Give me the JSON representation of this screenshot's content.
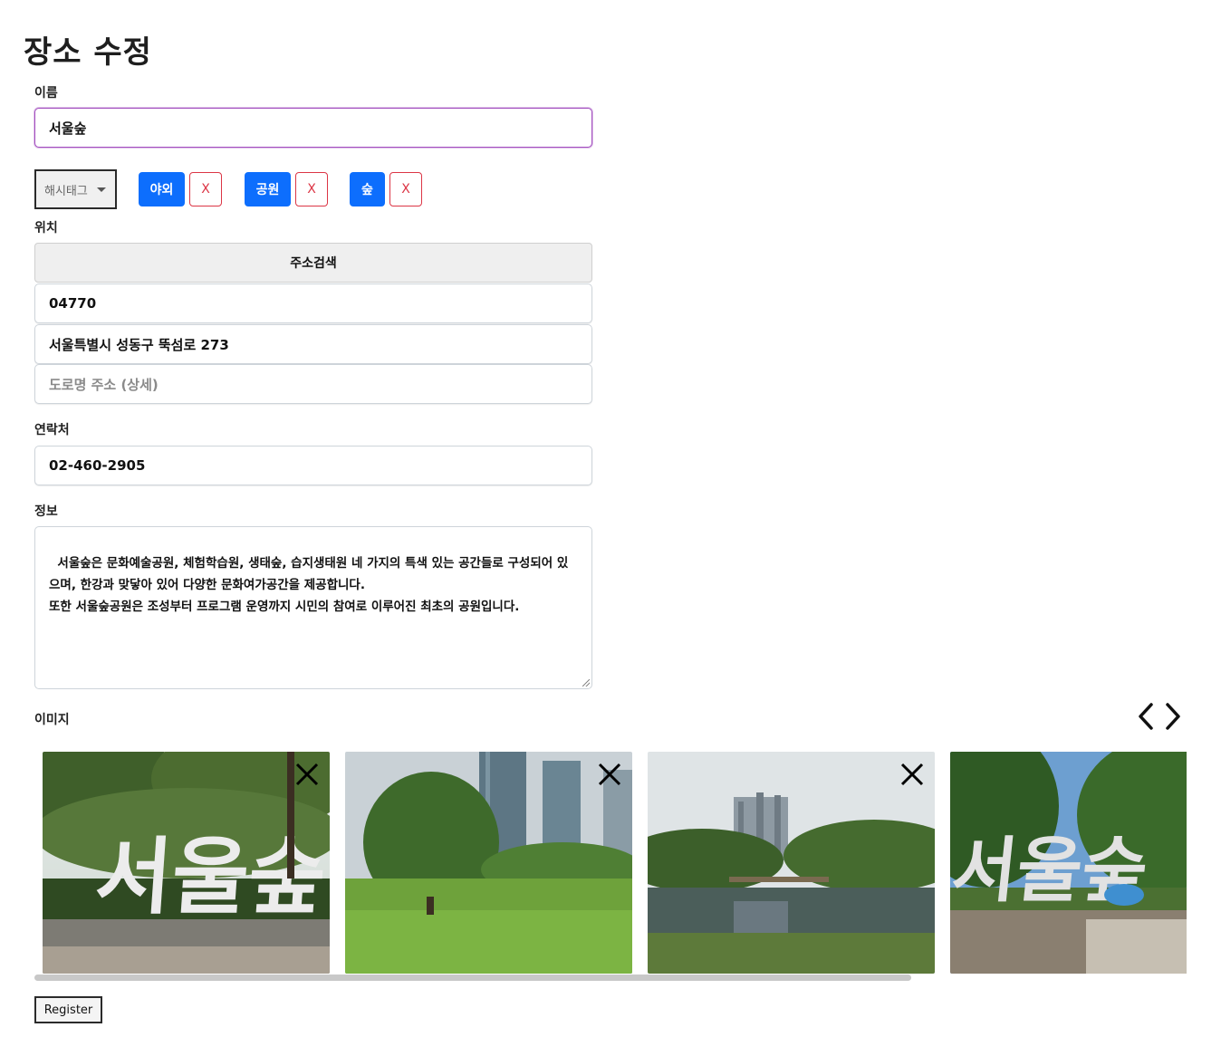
{
  "page": {
    "title": "장소 수정"
  },
  "name": {
    "label": "이름",
    "value": "서울숲"
  },
  "hashtag": {
    "select_label": "해시태그",
    "tags": [
      {
        "label": "야외",
        "remove": "X"
      },
      {
        "label": "공원",
        "remove": "X"
      },
      {
        "label": "숲",
        "remove": "X"
      }
    ]
  },
  "location": {
    "label": "위치",
    "search_button": "주소검색",
    "postcode": "04770",
    "address": "서울특별시 성동구 뚝섬로 273",
    "detail_placeholder": "도로명 주소 (상세)"
  },
  "contact": {
    "label": "연락처",
    "value": "02-460-2905"
  },
  "info": {
    "label": "정보",
    "value": "서울숲은 문화예술공원, 체험학습원, 생태숲, 습지생태원 네 가지의 특색 있는 공간들로 구성되어 있으며, 한강과 맞닿아 있어 다양한 문화여가공간을 제공합니다.\n또한 서울숲공원은 조성부터 프로그램 운영까지 시민의 참여로 이루어진 최초의 공원입니다."
  },
  "images": {
    "label": "이미지",
    "prev_icon": "chevron-left-icon",
    "next_icon": "chevron-right-icon",
    "items": [
      {
        "name": "seoul-forest-sign-photo",
        "removable": true
      },
      {
        "name": "park-lawn-towers-photo",
        "removable": true
      },
      {
        "name": "wetland-pond-photo",
        "removable": true
      },
      {
        "name": "seoul-forest-sign-photo-2",
        "removable": false
      }
    ]
  },
  "register": {
    "label": "Register"
  },
  "colors": {
    "primary": "#0d6efd",
    "danger": "#dc3545",
    "focus": "#a34fbf"
  }
}
